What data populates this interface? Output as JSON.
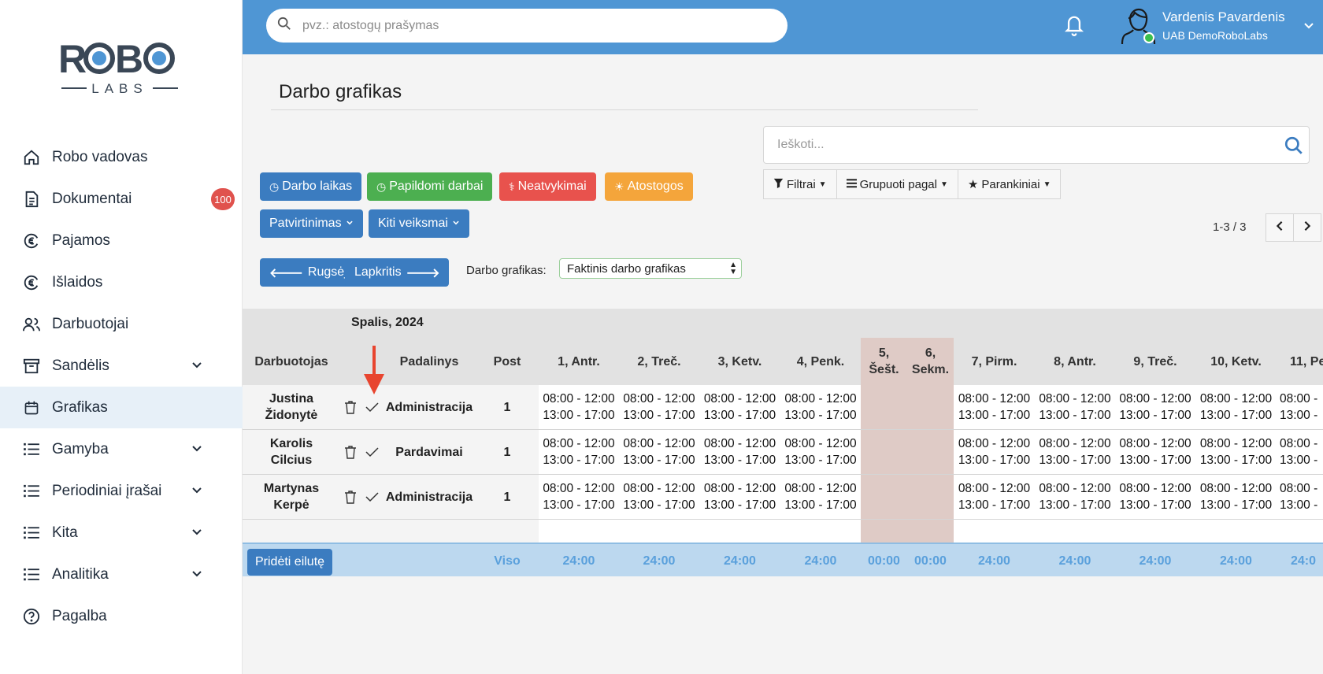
{
  "logo": {
    "top": "ROBO",
    "bottom": "LABS"
  },
  "sidebar": {
    "items": [
      {
        "label": "Robo vadovas",
        "icon": "home-icon"
      },
      {
        "label": "Dokumentai",
        "icon": "document-icon",
        "badge": "100"
      },
      {
        "label": "Pajamos",
        "icon": "euro-income-icon"
      },
      {
        "label": "Išlaidos",
        "icon": "euro-expense-icon"
      },
      {
        "label": "Darbuotojai",
        "icon": "users-icon"
      },
      {
        "label": "Sandėlis",
        "icon": "archive-icon"
      },
      {
        "label": "Grafikas",
        "icon": "calendar-icon"
      },
      {
        "label": "Gamyba",
        "icon": "list-icon"
      },
      {
        "label": "Periodiniai įrašai",
        "icon": "list-icon"
      },
      {
        "label": "Kita",
        "icon": "list-icon"
      },
      {
        "label": "Analitika",
        "icon": "list-icon"
      },
      {
        "label": "Pagalba",
        "icon": "help-icon"
      }
    ]
  },
  "topbar": {
    "search_placeholder": "pvz.: atostogų prašymas",
    "user_name": "Vardenis Pavardenis",
    "user_company": "UAB DemoRoboLabs"
  },
  "page": {
    "title": "Darbo grafikas",
    "buttons": {
      "work_time": "Darbo laikas",
      "extra_work": "Papildomi darbai",
      "absences": "Neatvykimai",
      "vacations": "Atostogos",
      "approval": "Patvirtinimas",
      "other_actions": "Kiti veiksmai",
      "prev_month": "Rugsėjis",
      "next_month": "Lapkritis"
    },
    "search_placeholder": "Ieškoti...",
    "filters": "Filtrai",
    "group_by": "Grupuoti pagal",
    "favorites": "Parankiniai",
    "pager": "1-3 / 3",
    "schedule_label": "Darbo grafikas:",
    "schedule_value": "Faktinis darbo grafikas"
  },
  "table": {
    "month": "Spalis, 2024",
    "headers": {
      "employee": "Darbuotojas",
      "department": "Padalinys",
      "post": "Post"
    },
    "days": [
      "1, Antr.",
      "2, Treč.",
      "3, Ketv.",
      "4, Penk.",
      "5, Šešt.",
      "6, Sekm.",
      "7, Pirm.",
      "8, Antr.",
      "9, Treč.",
      "10, Ketv.",
      "11, Pe"
    ],
    "rows": [
      {
        "first": "Justina",
        "last": "Židonytė",
        "department": "Administracija",
        "post": "1"
      },
      {
        "first": "Karolis",
        "last": "Cilcius",
        "department": "Pardavimai",
        "post": "1"
      },
      {
        "first": "Martynas",
        "last": "Kerpė",
        "department": "Administracija",
        "post": "1"
      }
    ],
    "shift_line1": "08:00 - 12:00",
    "shift_line2": "13:00 - 17:00",
    "shift_cut1": "08:00 -",
    "shift_cut2": "13:00 -",
    "add_row": "Pridėti eilutę",
    "total_label": "Viso",
    "totals": [
      "24:00",
      "24:00",
      "24:00",
      "24:00",
      "00:00",
      "00:00",
      "24:00",
      "24:00",
      "24:00",
      "24:00",
      "24:0"
    ]
  }
}
